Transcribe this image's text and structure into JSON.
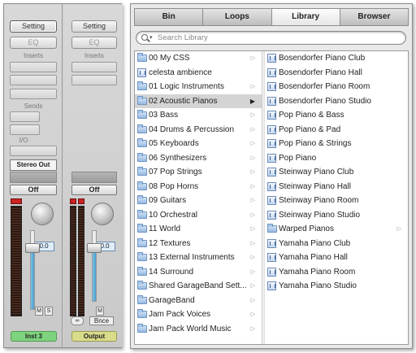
{
  "mixer": {
    "strip1": {
      "setting": "Setting",
      "eq": "EQ",
      "inserts": "Inserts",
      "sends": "Sends",
      "io": "I/O",
      "output_route": "Stereo Out",
      "off": "Off",
      "volume": "0.0",
      "mute": "M",
      "solo": "S",
      "name": "Inst 3",
      "name_color": "#7fd37f"
    },
    "strip2": {
      "setting": "Setting",
      "eq": "EQ",
      "inserts": "Inserts",
      "off": "Off",
      "volume": "0.0",
      "mute": "M",
      "bnce": "Bnce",
      "name": "Output",
      "name_color": "#d9dc8a"
    }
  },
  "browser": {
    "tabs": [
      "Bin",
      "Loops",
      "Library",
      "Browser"
    ],
    "active_tab": "Library",
    "search_placeholder": "Search Library",
    "column1": [
      {
        "label": "00 My CSS",
        "type": "folder"
      },
      {
        "label": "celesta ambience",
        "type": "patch"
      },
      {
        "label": "01 Logic Instruments",
        "type": "folder"
      },
      {
        "label": "02 Acoustic Pianos",
        "type": "folder",
        "selected": true
      },
      {
        "label": "03 Bass",
        "type": "folder"
      },
      {
        "label": "04 Drums & Percussion",
        "type": "folder"
      },
      {
        "label": "05 Keyboards",
        "type": "folder"
      },
      {
        "label": "06 Synthesizers",
        "type": "folder"
      },
      {
        "label": "07 Pop Strings",
        "type": "folder"
      },
      {
        "label": "08 Pop Horns",
        "type": "folder"
      },
      {
        "label": "09 Guitars",
        "type": "folder"
      },
      {
        "label": "10 Orchestral",
        "type": "folder"
      },
      {
        "label": "11 World",
        "type": "folder"
      },
      {
        "label": "12 Textures",
        "type": "folder"
      },
      {
        "label": "13 External Instruments",
        "type": "folder"
      },
      {
        "label": "14 Surround",
        "type": "folder"
      },
      {
        "label": "Shared GarageBand Sett...",
        "type": "folder"
      },
      {
        "label": "GarageBand",
        "type": "folder"
      },
      {
        "label": "Jam Pack Voices",
        "type": "folder"
      },
      {
        "label": "Jam Pack World Music",
        "type": "folder"
      }
    ],
    "column2": [
      {
        "label": "Bosendorfer Piano Club",
        "type": "patch"
      },
      {
        "label": "Bosendorfer Piano Hall",
        "type": "patch"
      },
      {
        "label": "Bosendorfer Piano Room",
        "type": "patch"
      },
      {
        "label": "Bosendorfer Piano Studio",
        "type": "patch"
      },
      {
        "label": "Pop Piano & Bass",
        "type": "patch"
      },
      {
        "label": "Pop Piano & Pad",
        "type": "patch"
      },
      {
        "label": "Pop Piano & Strings",
        "type": "patch"
      },
      {
        "label": "Pop Piano",
        "type": "patch"
      },
      {
        "label": "Steinway Piano Club",
        "type": "patch"
      },
      {
        "label": "Steinway Piano Hall",
        "type": "patch"
      },
      {
        "label": "Steinway Piano Room",
        "type": "patch"
      },
      {
        "label": "Steinway Piano Studio",
        "type": "patch"
      },
      {
        "label": "Warped Pianos",
        "type": "folder"
      },
      {
        "label": "Yamaha Piano Club",
        "type": "patch"
      },
      {
        "label": "Yamaha Piano Hall",
        "type": "patch"
      },
      {
        "label": "Yamaha Piano Room",
        "type": "patch"
      },
      {
        "label": "Yamaha Piano Studio",
        "type": "patch"
      }
    ]
  }
}
